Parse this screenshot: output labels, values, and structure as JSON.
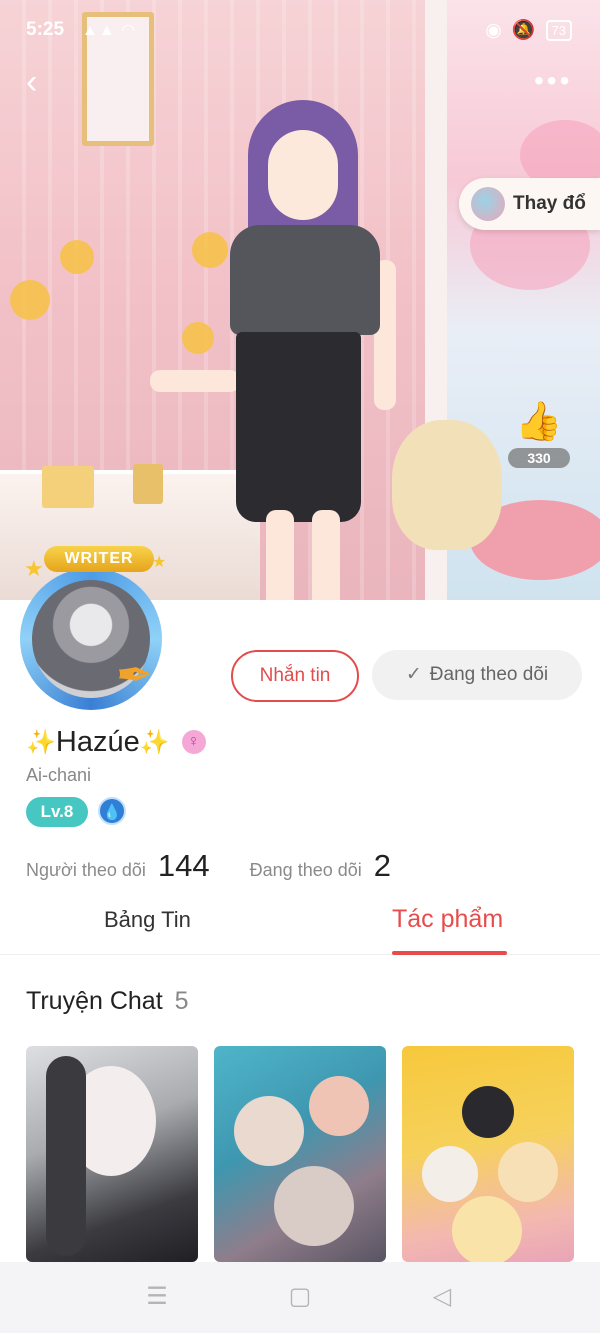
{
  "status_bar": {
    "time": "5:25",
    "signal": "▲▲ ◠",
    "icons_right": [
      "focus-icon",
      "mute-icon"
    ],
    "battery": "73"
  },
  "hero": {
    "change_label": "Thay đổ",
    "likes": "330"
  },
  "profile": {
    "badge": "WRITER",
    "message_button": "Nhắn tin",
    "following_button": "Đang theo dõi",
    "name": "Hazúe",
    "name_decoration": "✨",
    "gender_symbol": "♀",
    "handle": "Ai-chani",
    "level": "Lv.8",
    "stats": {
      "followers_label": "Người theo dõi",
      "followers": "144",
      "following_label": "Đang theo dõi",
      "following": "2"
    }
  },
  "tabs": [
    {
      "label": "Bảng Tin",
      "active": false
    },
    {
      "label": "Tác phẩm",
      "active": true
    }
  ],
  "section": {
    "title": "Truyện Chat",
    "count": "5"
  },
  "colors": {
    "accent": "#e84b4b",
    "level_badge": "#47c7c2",
    "like": "#e8322f"
  }
}
